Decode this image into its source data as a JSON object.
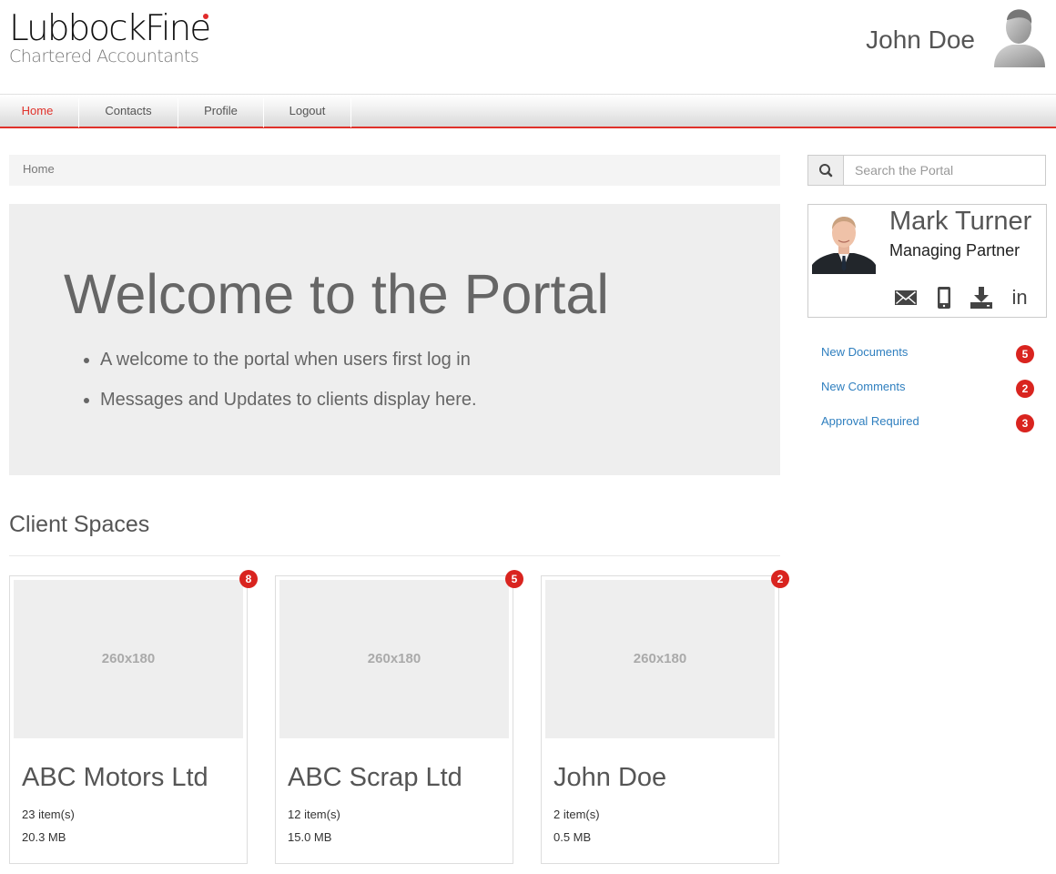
{
  "brand": {
    "name": "LubbockFine",
    "tagline": "Chartered Accountants",
    "accent_color": "#e0322b"
  },
  "user": {
    "name": "John Doe",
    "avatar_icon": "user-silhouette-icon"
  },
  "nav": {
    "items": [
      {
        "label": "Home",
        "active": true
      },
      {
        "label": "Contacts",
        "active": false
      },
      {
        "label": "Profile",
        "active": false
      },
      {
        "label": "Logout",
        "active": false
      }
    ]
  },
  "breadcrumb": {
    "current": "Home"
  },
  "hero": {
    "title": "Welcome to the Portal",
    "bullets": [
      "A welcome to the portal when users first log in",
      "Messages and Updates to clients display here."
    ]
  },
  "client_spaces": {
    "title": "Client Spaces",
    "cards": [
      {
        "thumb_label": "260x180",
        "title": "ABC Motors Ltd",
        "items": "23 item(s)",
        "size": "20.3 MB",
        "badge": "8"
      },
      {
        "thumb_label": "260x180",
        "title": "ABC Scrap Ltd",
        "items": "12 item(s)",
        "size": "15.0 MB",
        "badge": "5"
      },
      {
        "thumb_label": "260x180",
        "title": "John Doe",
        "items": "2 item(s)",
        "size": "0.5 MB",
        "badge": "2"
      }
    ]
  },
  "search": {
    "placeholder": "Search the Portal",
    "icon": "search-icon"
  },
  "contact": {
    "name": "Mark Turner",
    "role": "Managing Partner",
    "actions": [
      {
        "icon": "email-icon"
      },
      {
        "icon": "mobile-phone-icon"
      },
      {
        "icon": "download-icon"
      },
      {
        "icon": "linkedin-icon",
        "label": "in"
      }
    ]
  },
  "notifications": [
    {
      "label": "New Documents",
      "count": "5"
    },
    {
      "label": "New Comments",
      "count": "2"
    },
    {
      "label": "Approval Required",
      "count": "3"
    }
  ]
}
